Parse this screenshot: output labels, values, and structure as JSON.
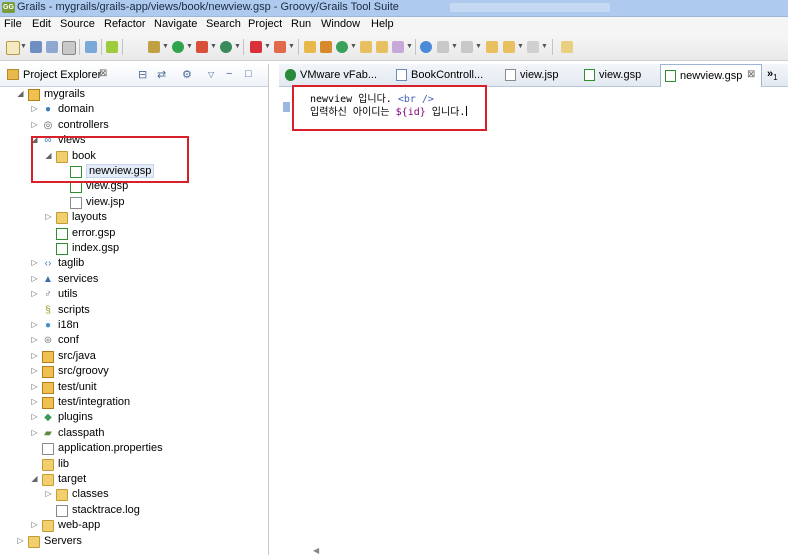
{
  "window": {
    "app_badge": "GG",
    "title": "Grails - mygrails/grails-app/views/book/newview.gsp - Groovy/Grails Tool Suite"
  },
  "menu": [
    "File",
    "Edit",
    "Source",
    "Refactor",
    "Navigate",
    "Search",
    "Project",
    "Run",
    "Window",
    "Help"
  ],
  "left_panel": {
    "title": "Project Explorer",
    "close_glyph": "⊠",
    "tree": [
      {
        "label": "mygrails",
        "icon": "project-icon",
        "depth": 0,
        "expanded": true
      },
      {
        "label": "domain",
        "icon": "domain-icon",
        "depth": 1,
        "expanded": false
      },
      {
        "label": "controllers",
        "icon": "controllers-icon",
        "depth": 1,
        "expanded": false
      },
      {
        "label": "views",
        "icon": "views-icon",
        "depth": 1,
        "expanded": true
      },
      {
        "label": "book",
        "icon": "folder-icon",
        "depth": 2,
        "expanded": true
      },
      {
        "label": "newview.gsp",
        "icon": "gsp-file-icon",
        "depth": 3,
        "selected": true
      },
      {
        "label": "view.gsp",
        "icon": "gsp-file-icon",
        "depth": 3
      },
      {
        "label": "view.jsp",
        "icon": "jsp-file-icon",
        "depth": 3
      },
      {
        "label": "layouts",
        "icon": "folder-icon",
        "depth": 2,
        "expanded": false
      },
      {
        "label": "error.gsp",
        "icon": "gsp-file-icon",
        "depth": 2
      },
      {
        "label": "index.gsp",
        "icon": "gsp-file-icon",
        "depth": 2
      },
      {
        "label": "taglib",
        "icon": "taglib-icon",
        "depth": 1,
        "expanded": false
      },
      {
        "label": "services",
        "icon": "services-icon",
        "depth": 1,
        "expanded": false
      },
      {
        "label": "utils",
        "icon": "utils-icon",
        "depth": 1,
        "expanded": false
      },
      {
        "label": "scripts",
        "icon": "scripts-icon",
        "depth": 1
      },
      {
        "label": "i18n",
        "icon": "i18n-icon",
        "depth": 1,
        "expanded": false
      },
      {
        "label": "conf",
        "icon": "conf-icon",
        "depth": 1,
        "expanded": false
      },
      {
        "label": "src/java",
        "icon": "source-folder-icon",
        "depth": 1,
        "expanded": false
      },
      {
        "label": "src/groovy",
        "icon": "source-folder-icon",
        "depth": 1,
        "expanded": false
      },
      {
        "label": "test/unit",
        "icon": "source-folder-icon",
        "depth": 1,
        "expanded": false
      },
      {
        "label": "test/integration",
        "icon": "source-folder-icon",
        "depth": 1,
        "expanded": false
      },
      {
        "label": "plugins",
        "icon": "plugins-icon",
        "depth": 1,
        "expanded": false
      },
      {
        "label": "classpath",
        "icon": "classpath-icon",
        "depth": 1,
        "expanded": false
      },
      {
        "label": "application.properties",
        "icon": "properties-file-icon",
        "depth": 1
      },
      {
        "label": "lib",
        "icon": "folder-icon",
        "depth": 1
      },
      {
        "label": "target",
        "icon": "folder-icon",
        "depth": 1,
        "expanded": true
      },
      {
        "label": "classes",
        "icon": "folder-icon",
        "depth": 2,
        "expanded": false
      },
      {
        "label": "stacktrace.log",
        "icon": "log-file-icon",
        "depth": 2
      },
      {
        "label": "web-app",
        "icon": "folder-icon",
        "depth": 1,
        "expanded": false
      },
      {
        "label": "Servers",
        "icon": "folder-icon",
        "depth": 0,
        "expanded": false
      }
    ]
  },
  "editor": {
    "tabs": [
      {
        "label": "VMware vFab...",
        "icon": "vfabric-icon",
        "active": false
      },
      {
        "label": "BookControll...",
        "icon": "groovy-file-icon",
        "active": false
      },
      {
        "label": "view.jsp",
        "icon": "jsp-file-icon",
        "active": false
      },
      {
        "label": "view.gsp",
        "icon": "gsp-file-icon",
        "active": false
      },
      {
        "label": "newview.gsp",
        "icon": "gsp-file-icon",
        "active": true
      }
    ],
    "overflow_label": "»",
    "overflow_count": "1",
    "code": {
      "line1_text": "newview 입니다.",
      "line1_tag": "<br />",
      "line2_text_before": "입력하신 아이디는 ",
      "line2_expr": "${id}",
      "line2_text_after": " 입니다."
    }
  },
  "colors": {
    "highlight_box": "#d8202a",
    "titlebar": "#aecbef",
    "selection": "#e4ecf7"
  }
}
